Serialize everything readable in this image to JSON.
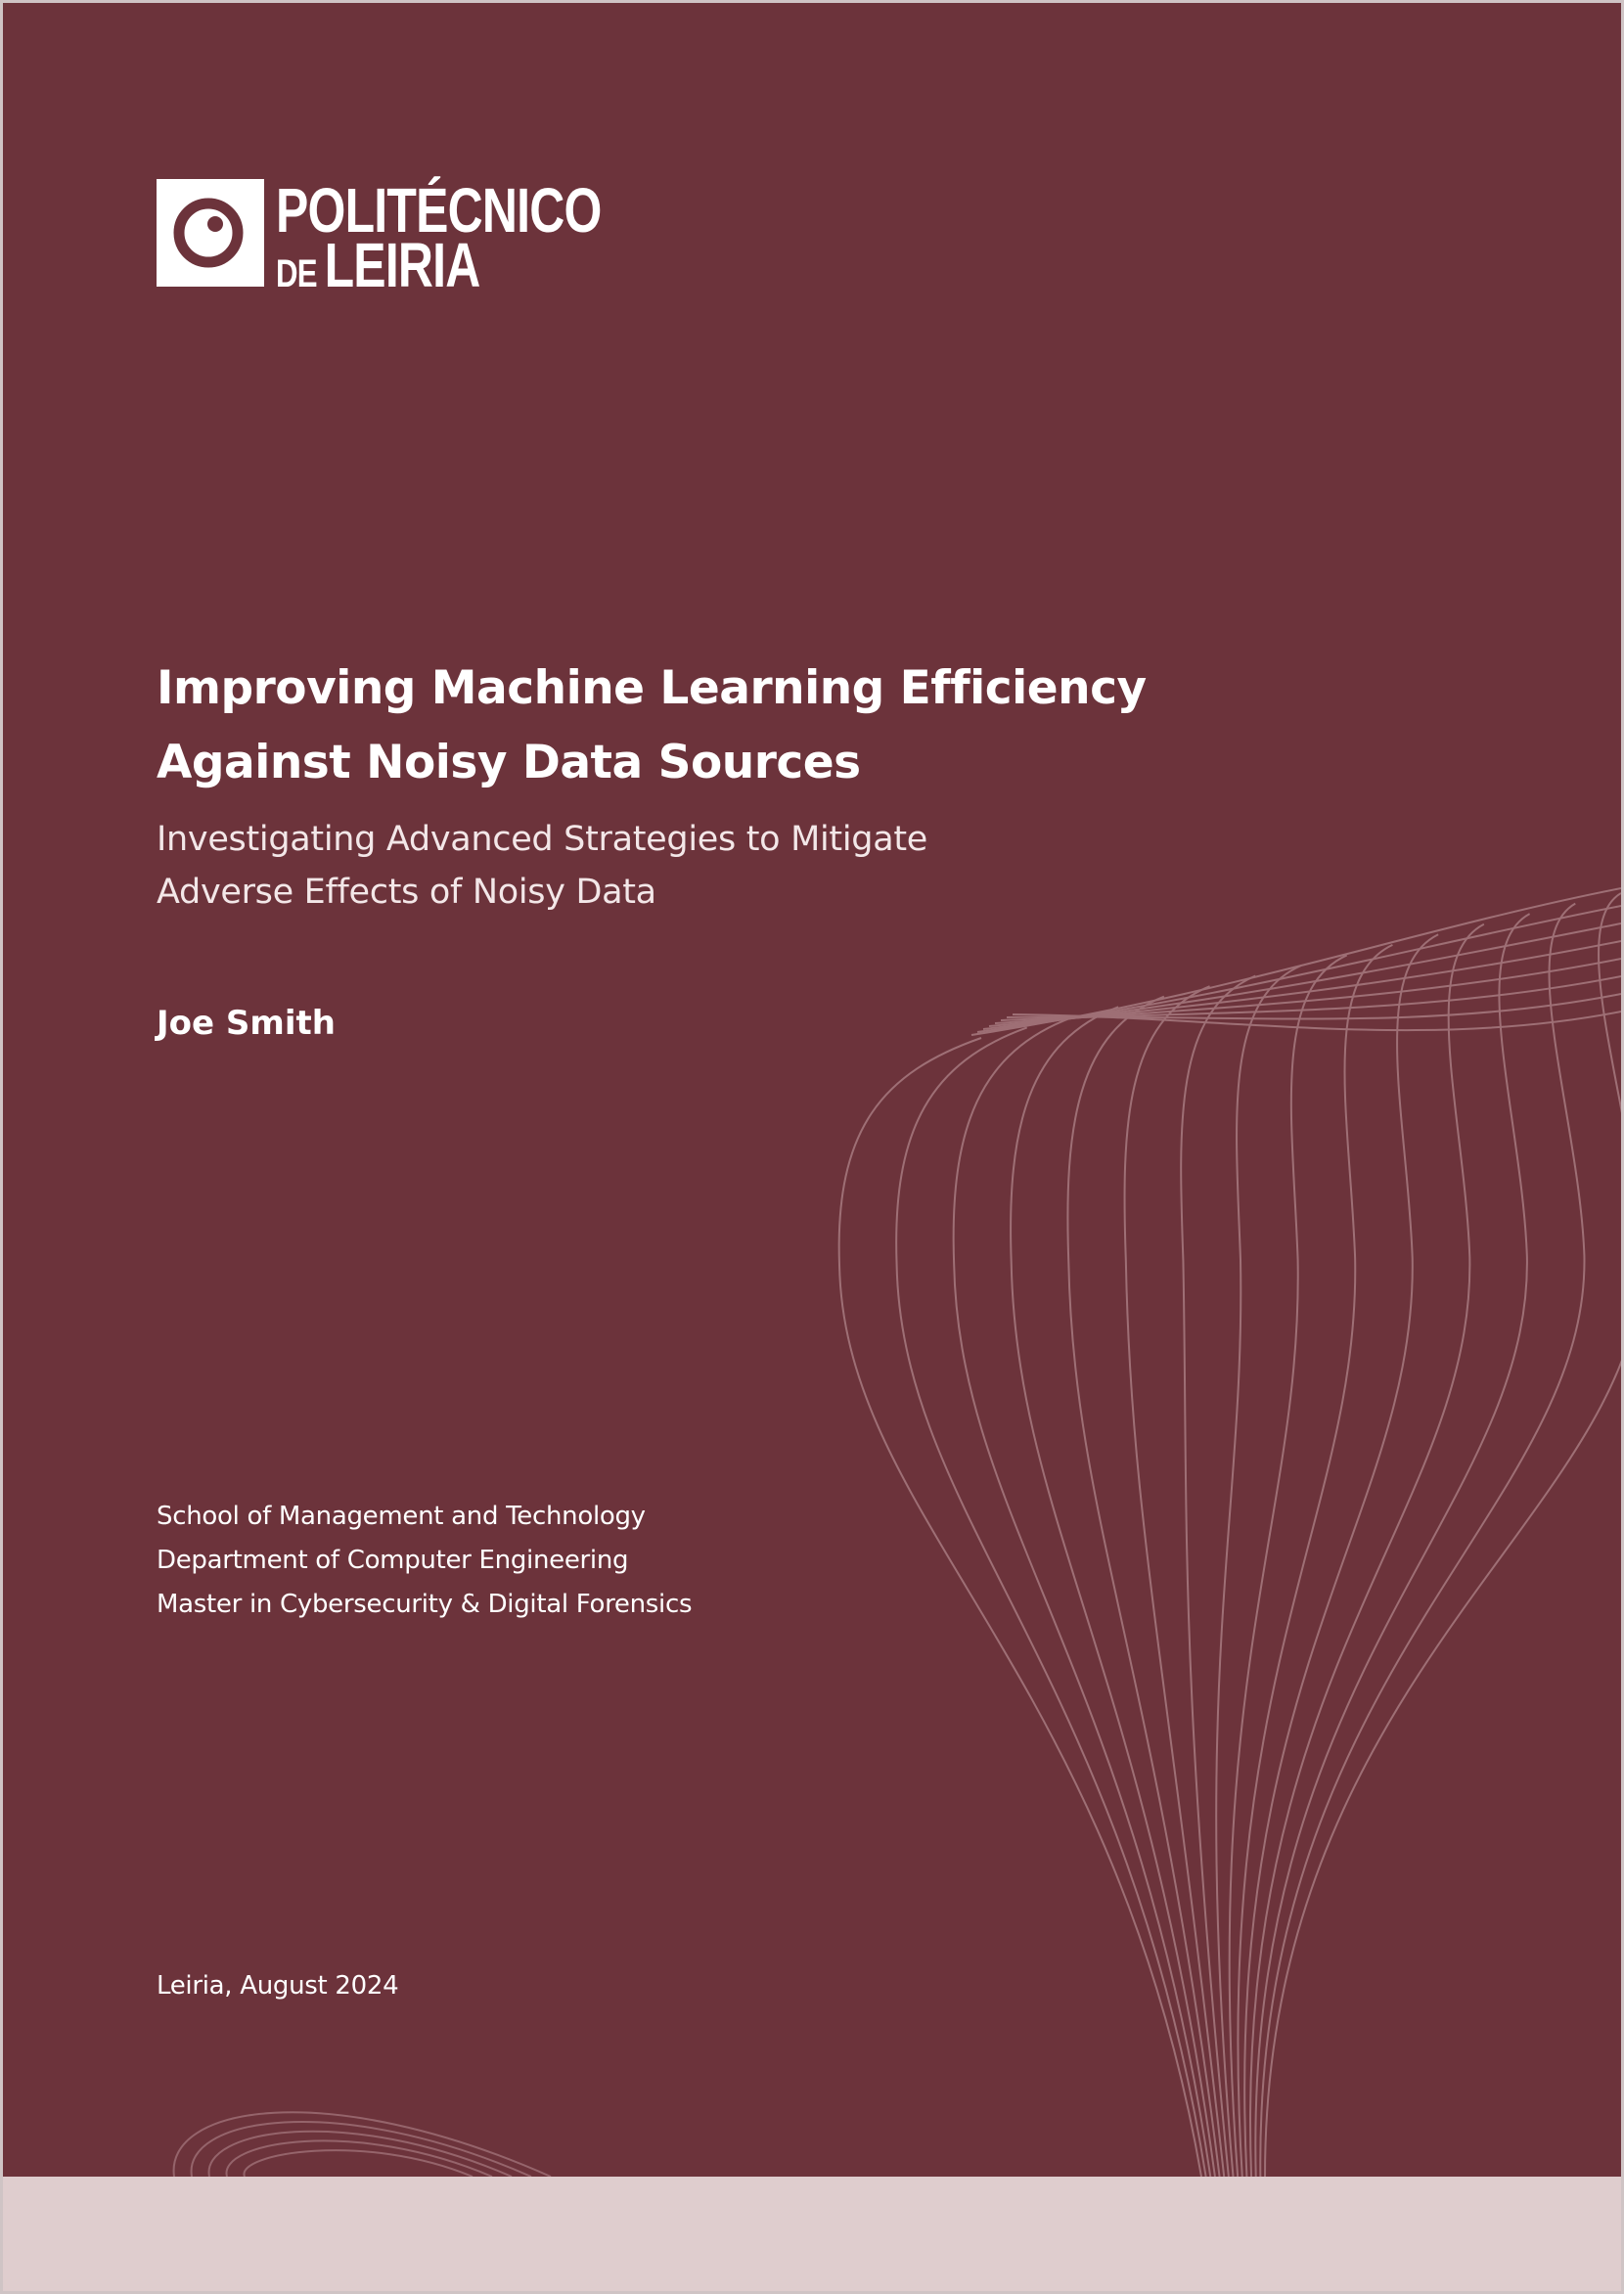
{
  "cover": {
    "institution": {
      "line1": "POLITÉCNICO",
      "line2_small": "DE",
      "line2_large": "LEIRIA"
    },
    "title_lines": [
      "Improving Machine Learning Efficiency",
      "Against Noisy Data Sources"
    ],
    "subtitle_lines": [
      "Investigating Advanced Strategies to Mitigate",
      "Adverse Effects of Noisy Data"
    ],
    "author": "Joe Smith",
    "affiliation_lines": [
      "School of Management and Technology",
      "Department of Computer Engineering",
      "Master in Cybersecurity & Digital Forensics"
    ],
    "place_date": "Leiria, August 2024"
  },
  "colors": {
    "cover_background": "#6c333b",
    "footer_band": "#dfcdce",
    "text": "#ffffff",
    "decor_lines": "#a77a80"
  },
  "icons": {
    "logo_mark": "circle-eye-icon",
    "decoration": "wireframe-wave-graphic"
  }
}
